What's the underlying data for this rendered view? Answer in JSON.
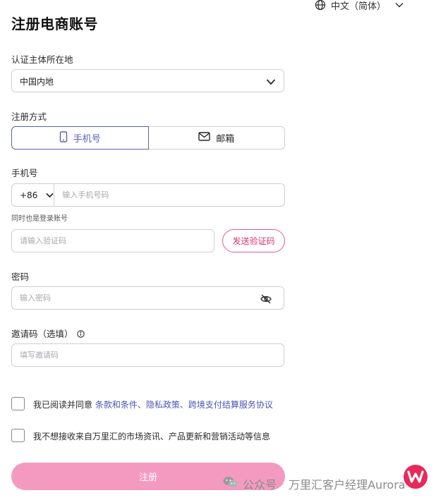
{
  "header": {
    "language": "中文（简体）",
    "title": "注册电商账号"
  },
  "form": {
    "region": {
      "label": "认证主体所在地",
      "value": "中国内地"
    },
    "method": {
      "label": "注册方式",
      "options": [
        "手机号",
        "邮箱"
      ],
      "selected": "手机号"
    },
    "phone": {
      "label": "手机号",
      "country_code": "+86",
      "placeholder": "输入手机号码",
      "hint": "同时也是登录账号"
    },
    "verification": {
      "placeholder": "请输入验证码",
      "send_label": "发送验证码"
    },
    "password": {
      "label": "密码",
      "placeholder": "输入密码"
    },
    "invite": {
      "label": "邀请码（选填）",
      "placeholder": "填写邀请码"
    },
    "agreement": {
      "prefix": "我已阅读并同意 ",
      "links": "条款和条件、隐私政策、跨境支付结算服务协议",
      "checked": false
    },
    "marketing_opt_out": {
      "text": "我不想接收来自万里汇的市场资讯、产品更新和营销活动等信息",
      "checked": false
    },
    "submit_label": "注册"
  },
  "watermark": {
    "prefix": "公众号",
    "separator": "·",
    "text": "万里汇客户经理Aurora"
  },
  "colors": {
    "accent": "#5b5fb5",
    "link": "#4b56b8",
    "brand_pink": "#d8336a",
    "submit_bg": "#f49ac0"
  },
  "icons": [
    "globe-icon",
    "chevron-down-icon",
    "phone-icon",
    "mail-icon",
    "eye-off-icon",
    "info-icon",
    "wechat-icon",
    "worldfirst-logo-icon"
  ]
}
